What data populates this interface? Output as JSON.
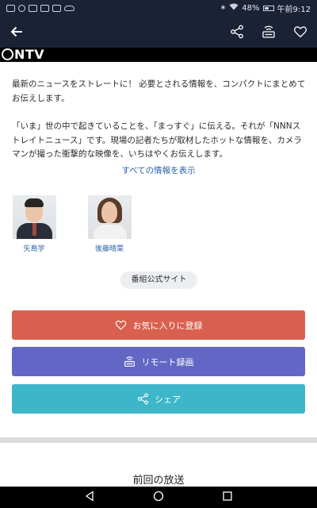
{
  "status_bar": {
    "battery": "48%",
    "time": "午前9:12"
  },
  "app_bar": {
    "back_icon": "arrow-left-icon",
    "share_icon": "share-icon",
    "remote_record_icon": "remote-record-icon",
    "favorite_icon": "heart-icon"
  },
  "channel_logo": "NTV",
  "description": {
    "paragraph1": "最新のニュースをストレートに！ 必要とされる情報を、コンパクトにまとめてお伝えします。",
    "paragraph2": "「いま」世の中で起きていることを、「まっすぐ」に伝える。それが「NNNストレイトニュース」です。現場の記者たちが取材したホットな情報を、カメラマンが撮った衝撃的な映像を、いちはやくお伝えします。",
    "show_all": "すべての情報を表示"
  },
  "casters": [
    {
      "name": "矢島学"
    },
    {
      "name": "後藤晴菜"
    }
  ],
  "official_site": "番組公式サイト",
  "buttons": {
    "favorite": "お気に入りに登録",
    "remote_record": "リモート録画",
    "share": "シェア"
  },
  "section": {
    "previous_broadcast": "前回の放送"
  },
  "colors": {
    "header_bg": "#1b2236",
    "favorite": "#d9604f",
    "remote_record": "#6266c4",
    "share": "#3db6c9",
    "link": "#2f63a7"
  }
}
